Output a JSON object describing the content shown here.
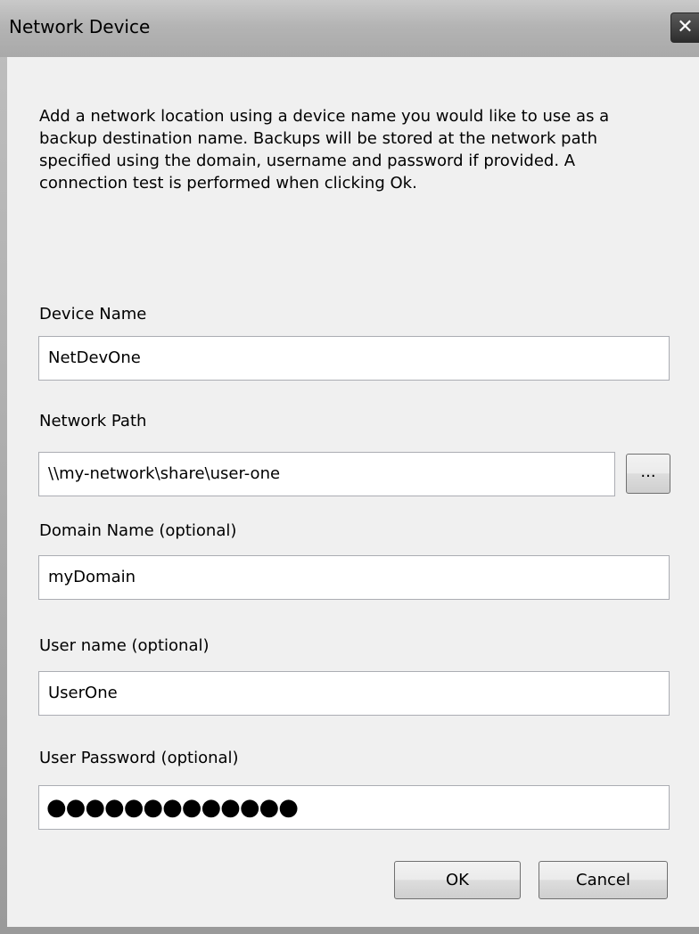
{
  "window": {
    "title": "Network Device",
    "close_glyph": "✕"
  },
  "description": "Add a network location using a device name you would like to use as a\nbackup destination name. Backups will be stored at the network path\nspecified using the domain, username and password if provided. A\nconnection test is performed when clicking Ok.",
  "fields": {
    "device_name": {
      "label": "Device Name",
      "value": "NetDevOne"
    },
    "network_path": {
      "label": "Network Path",
      "value": "\\\\my-network\\share\\user-one",
      "browse_label": "..."
    },
    "domain_name": {
      "label": "Domain Name (optional)",
      "value": "myDomain"
    },
    "user_name": {
      "label": "User name (optional)",
      "value": "UserOne"
    },
    "user_password": {
      "label": "User Password (optional)",
      "masked_value": "●●●●●●●●●●●●●"
    }
  },
  "buttons": {
    "ok": "OK",
    "cancel": "Cancel"
  },
  "colors": {
    "titlebar": "#b4b4b4",
    "client_background": "#f0f0f0",
    "close_button": "#2d2d2d"
  }
}
